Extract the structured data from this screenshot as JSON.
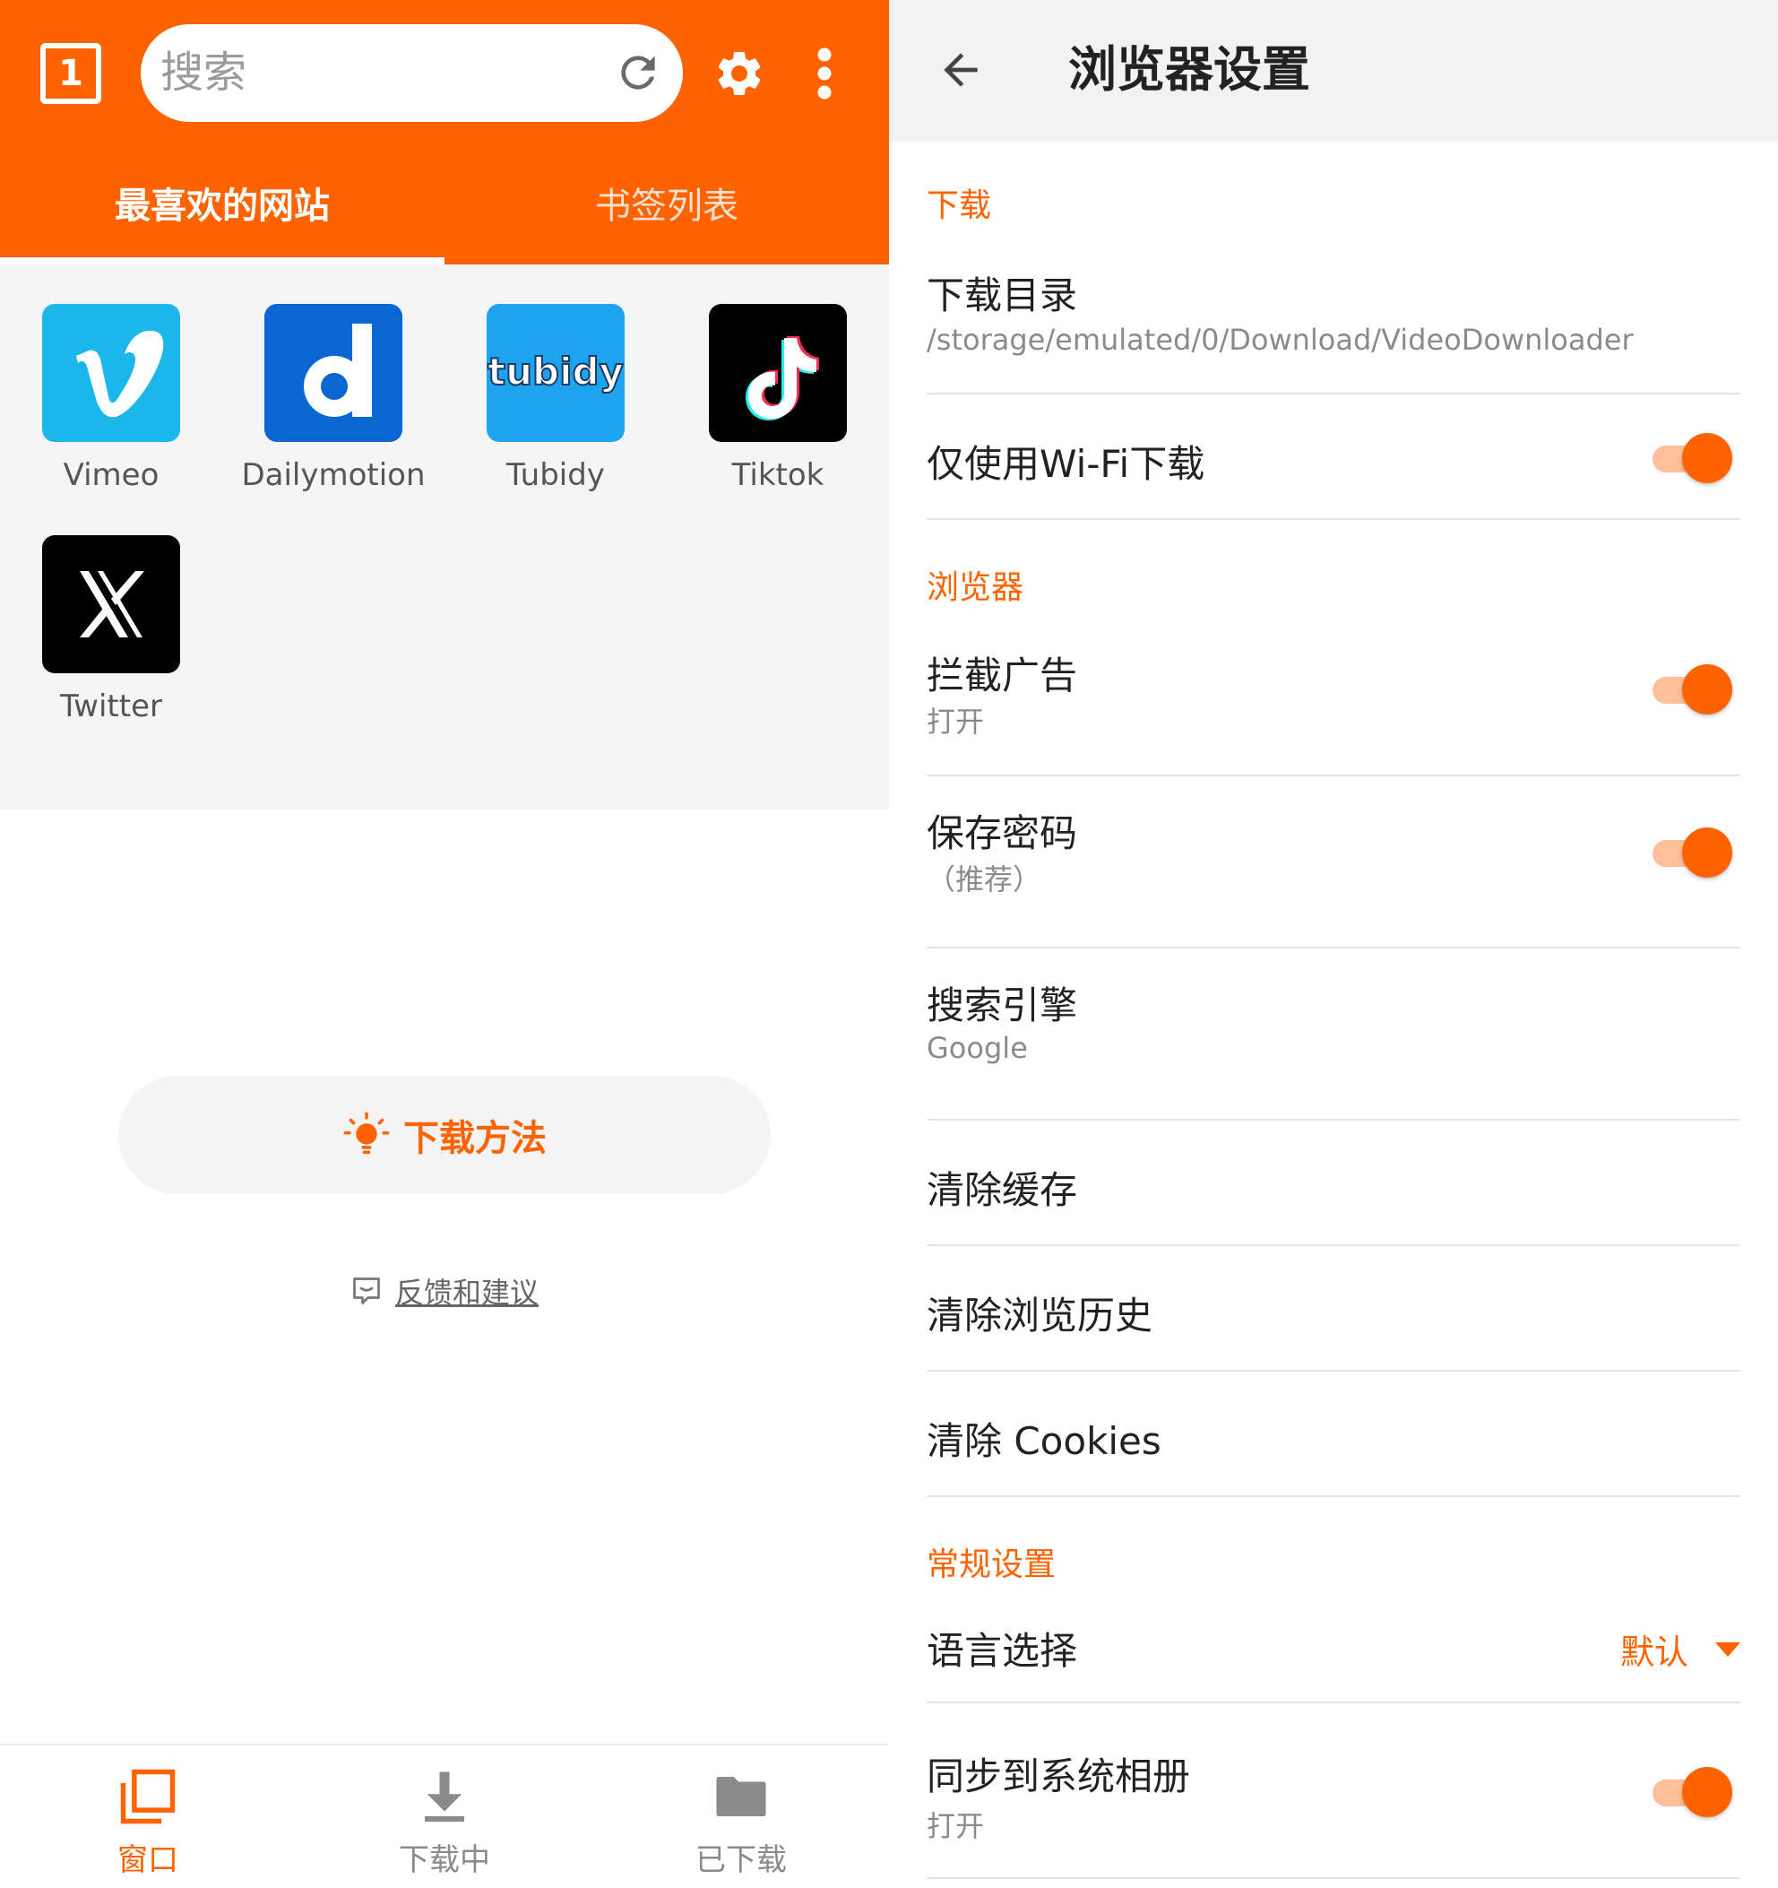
{
  "colors": {
    "brand_orange": "#ff6300",
    "toggle_track": "#ffbf98"
  },
  "left": {
    "tab_count": "1",
    "search": {
      "placeholder": "搜索"
    },
    "tabs": {
      "favorites": "最喜欢的网站",
      "bookmarks": "书签列表"
    },
    "sites": [
      {
        "label": "Vimeo",
        "icon": "vimeo-logo-icon"
      },
      {
        "label": "Dailymotion",
        "icon": "dailymotion-logo-icon"
      },
      {
        "label": "Tubidy",
        "icon": "tubidy-logo-icon",
        "logo_text": "tubidy"
      },
      {
        "label": "Tiktok",
        "icon": "tiktok-logo-icon"
      },
      {
        "label": "Twitter",
        "icon": "x-logo-icon"
      }
    ],
    "howto_label": "下载方法",
    "feedback_label": "反馈和建议",
    "bottom_nav": [
      {
        "label": "窗口",
        "icon": "windows-icon",
        "active": true
      },
      {
        "label": "下载中",
        "icon": "download-icon",
        "active": false
      },
      {
        "label": "已下载",
        "icon": "folder-icon",
        "active": false
      }
    ]
  },
  "right": {
    "title": "浏览器设置",
    "sections": {
      "download": "下载",
      "browser": "浏览器",
      "general": "常规设置"
    },
    "rows": {
      "download_dir": {
        "title": "下载目录",
        "sub": "/storage/emulated/0/Download/VideoDownloader"
      },
      "wifi_only": {
        "title": "仅使用Wi-Fi下载",
        "on": true
      },
      "block_ads": {
        "title": "拦截广告",
        "sub": "打开",
        "on": true
      },
      "save_password": {
        "title": "保存密码",
        "sub": "（推荐）",
        "on": true
      },
      "search_engine": {
        "title": "搜索引擎",
        "sub": "Google"
      },
      "clear_cache": {
        "title": "清除缓存"
      },
      "clear_history": {
        "title": "清除浏览历史"
      },
      "clear_cookies": {
        "title": "清除 Cookies"
      },
      "language": {
        "title": "语言选择",
        "value": "默认"
      },
      "sync_album": {
        "title": "同步到系统相册",
        "sub": "打开",
        "on": true
      }
    }
  }
}
